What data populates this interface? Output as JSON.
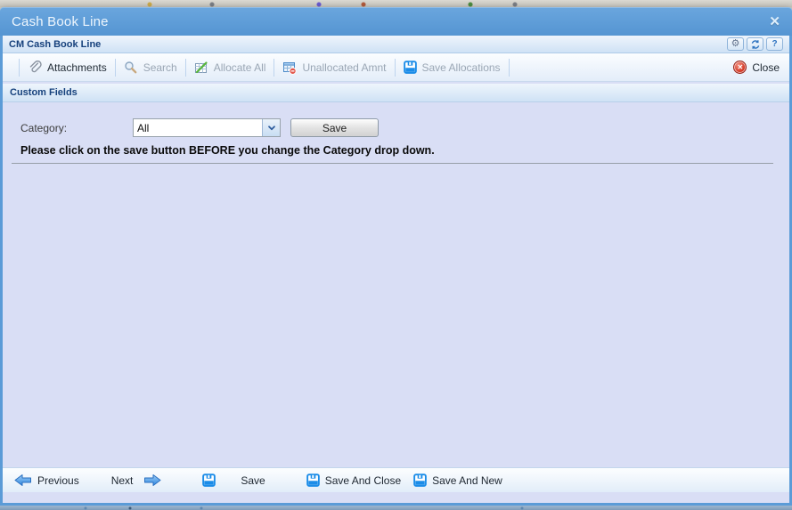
{
  "window": {
    "title": "Cash Book Line",
    "close_glyph": "✕"
  },
  "panel_header": {
    "title": "CM Cash Book Line",
    "help_glyph": "?"
  },
  "toolbar": {
    "attachments_label": "Attachments",
    "search_label": "Search",
    "allocate_all_label": "Allocate All",
    "unallocated_amnt_label": "Unallocated Amnt",
    "save_allocations_label": "Save Allocations",
    "close_label": "Close",
    "close_glyph": "✕"
  },
  "custom_fields": {
    "section_title": "Custom Fields",
    "category_label": "Category:",
    "category_value": "All",
    "save_button_label": "Save",
    "notice": "Please click on the save button BEFORE you change the Category drop down."
  },
  "footer": {
    "previous_label": "Previous",
    "next_label": "Next",
    "save_label": "Save",
    "save_and_close_label": "Save And Close",
    "save_and_new_label": "Save And New"
  },
  "colors": {
    "titlebar_blue": "#5b9bd7",
    "header_text_navy": "#16417c",
    "content_lavender": "#d9def5",
    "icon_blue": "#1b8ce8",
    "close_red": "#d53b28",
    "disabled_text": "#9aa6b4"
  }
}
